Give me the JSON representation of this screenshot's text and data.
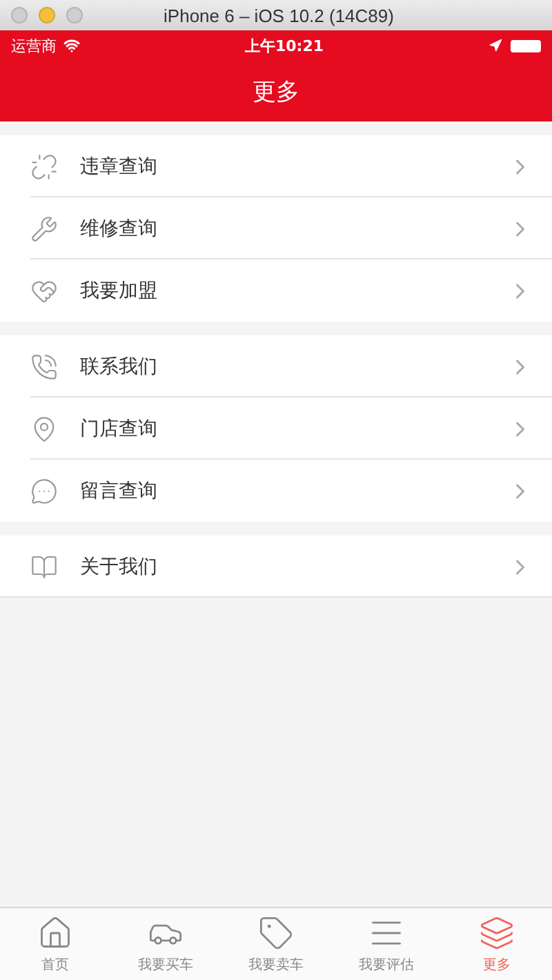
{
  "window": {
    "title": "iPhone 6 – iOS 10.2 (14C89)"
  },
  "status_bar": {
    "carrier": "运营商",
    "time": "上午10:21"
  },
  "nav_title": "更多",
  "groups": [
    {
      "items": [
        {
          "label": "违章查询"
        },
        {
          "label": "维修查询"
        },
        {
          "label": "我要加盟"
        }
      ]
    },
    {
      "items": [
        {
          "label": "联系我们"
        },
        {
          "label": "门店查询"
        },
        {
          "label": "留言查询"
        }
      ]
    },
    {
      "items": [
        {
          "label": "关于我们"
        }
      ]
    }
  ],
  "tab_bar": [
    {
      "label": "首页",
      "selected": false
    },
    {
      "label": "我要买车",
      "selected": false
    },
    {
      "label": "我要卖车",
      "selected": false
    },
    {
      "label": "我要评估",
      "selected": false
    },
    {
      "label": "更多",
      "selected": true
    }
  ]
}
